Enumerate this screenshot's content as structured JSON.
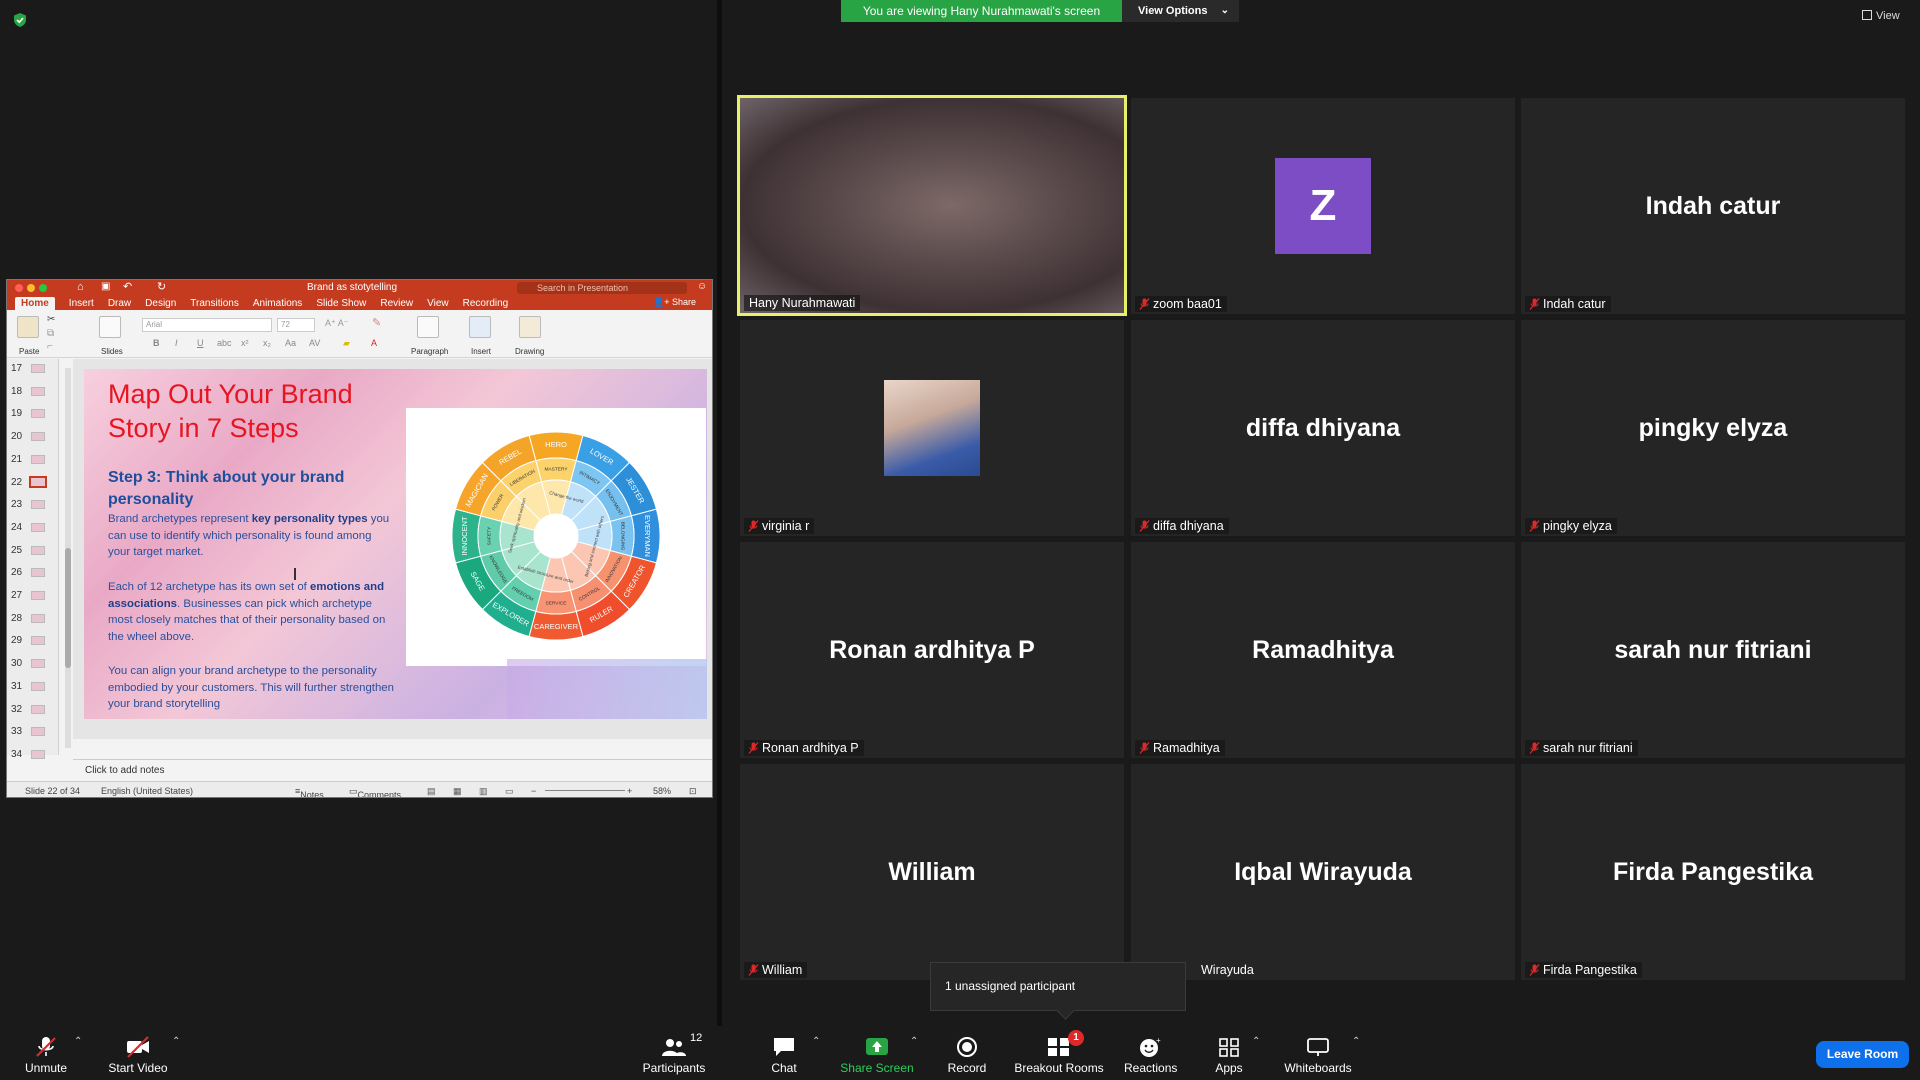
{
  "banner": {
    "viewing_text": "You are viewing Hany Nurahmawati's screen",
    "view_options_label": "View Options",
    "view_label": "View"
  },
  "ppt": {
    "title": "Brand as stotytelling",
    "search_placeholder": "Search in Presentation",
    "share_label": "Share",
    "tabs": [
      "Home",
      "Insert",
      "Draw",
      "Design",
      "Transitions",
      "Animations",
      "Slide Show",
      "Review",
      "View",
      "Recording"
    ],
    "ribbon": {
      "paste": "Paste",
      "slides": "Slides",
      "paragraph": "Paragraph",
      "insert": "Insert",
      "drawing": "Drawing",
      "font": "Arial",
      "size": "72"
    },
    "thumbnails": [
      "17",
      "18",
      "19",
      "20",
      "21",
      "22",
      "23",
      "24",
      "25",
      "26",
      "27",
      "28",
      "29",
      "30",
      "31",
      "32",
      "33",
      "34"
    ],
    "selected_thumbnail": "22",
    "slide": {
      "title_line1": "Map Out Your Brand",
      "title_line2": "Story in 7 Steps",
      "step_heading": "Step 3: Think about your brand personality",
      "p1_a": "Brand archetypes represent ",
      "p1_b": "key personality types",
      "p1_c": " you can use to identify which personality is found among your target market.",
      "p2_a": "Each  of 12 archetype has its own set of ",
      "p2_b": "emotions and associations",
      "p2_c": ". Businesses can pick which archetype most closely matches that of their personality based on the wheel above.",
      "p3": "You can align your brand archetype to the personality embodied by your customers. This will further strengthen your brand storytelling",
      "wheel_outer": [
        "HERO",
        "LOVER",
        "JESTER",
        "EVERYMAN",
        "CREATOR",
        "RULER",
        "CAREGIVER",
        "EXPLORER",
        "SAGE",
        "INNOCENT",
        "MAGICIAN",
        "REBEL"
      ],
      "wheel_mid": [
        "MASTERY",
        "INTIMACY",
        "ENJOYMENT",
        "BELONGING",
        "INNOVATION",
        "CONTROL",
        "SERVICE",
        "FREEDOM",
        "KNOWLEDGE",
        "SAFETY",
        "POWER",
        "LIBERATION"
      ],
      "wheel_inner": [
        "Change the world",
        "Belong and connect with others",
        "Establish structure and order",
        "Seek spirituality and wisdom"
      ]
    },
    "notes_placeholder": "Click to add notes",
    "status": {
      "slide_of": "Slide 22 of 34",
      "language": "English (United States)",
      "notes": "Notes",
      "comments": "Comments",
      "zoom": "58%"
    }
  },
  "participants": [
    {
      "name": "Hany Nurahmawati",
      "type": "video",
      "muted": false,
      "active": true
    },
    {
      "name": "zoom baa01",
      "type": "avatar",
      "initial": "Z",
      "muted": true
    },
    {
      "name": "Indah catur",
      "type": "name",
      "muted": true
    },
    {
      "name": "virginia r",
      "type": "photo",
      "muted": true
    },
    {
      "name": "diffa dhiyana",
      "type": "name",
      "muted": true
    },
    {
      "name": "pingky elyza",
      "type": "name",
      "muted": true
    },
    {
      "name": "Ronan ardhitya P",
      "type": "name",
      "muted": true
    },
    {
      "name": "Ramadhitya",
      "type": "name",
      "muted": true
    },
    {
      "name": "sarah nur fitriani",
      "type": "name",
      "muted": true
    },
    {
      "name": "William",
      "type": "name",
      "muted": true
    },
    {
      "name": "Iqbal Wirayuda",
      "type": "name",
      "muted": true,
      "label_visible": "Wirayuda"
    },
    {
      "name": "Firda Pangestika",
      "type": "name",
      "muted": true
    }
  ],
  "popup": {
    "text": "1 unassigned participant"
  },
  "toolbar": {
    "unmute": "Unmute",
    "start_video": "Start Video",
    "participants": "Participants",
    "participants_count": "12",
    "chat": "Chat",
    "share_screen": "Share Screen",
    "record": "Record",
    "breakout_rooms": "Breakout Rooms",
    "breakout_badge": "1",
    "reactions": "Reactions",
    "apps": "Apps",
    "whiteboards": "Whiteboards",
    "leave": "Leave Room"
  },
  "colors": {
    "zoom_green": "#29a444",
    "zoom_blue": "#0e71eb",
    "ppt_red": "#c43b1f",
    "active_speaker": "#e8f06a",
    "avatar_purple": "#7c4dc4",
    "mute_red": "#e02828"
  }
}
